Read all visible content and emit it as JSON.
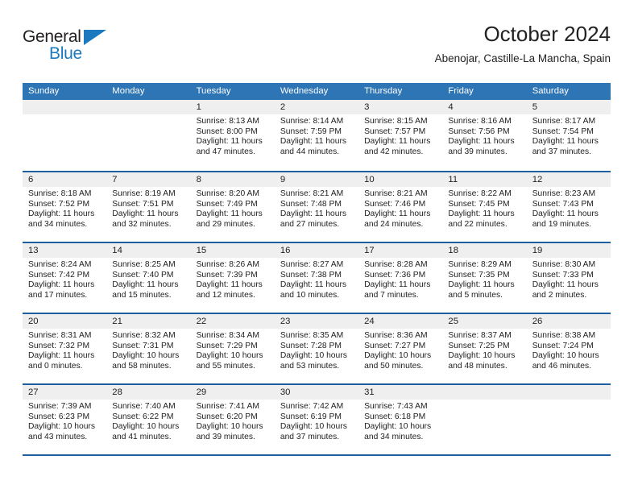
{
  "logo": {
    "word_one": "General",
    "word_two": "Blue",
    "triangle_color": "#1b7abf"
  },
  "header": {
    "title": "October 2024",
    "subtitle": "Abenojar, Castille-La Mancha, Spain"
  },
  "colors": {
    "header_blue": "#2e75b6",
    "separator_blue": "#1f5fa0",
    "day_band_gray": "#efefef"
  },
  "weekdays": [
    "Sunday",
    "Monday",
    "Tuesday",
    "Wednesday",
    "Thursday",
    "Friday",
    "Saturday"
  ],
  "labels": {
    "sunrise_prefix": "Sunrise:",
    "sunset_prefix": "Sunset:",
    "daylight_prefix": "Daylight:"
  },
  "weeks": [
    [
      {
        "date": "",
        "sunrise": "",
        "sunset": "",
        "daylight": ""
      },
      {
        "date": "",
        "sunrise": "",
        "sunset": "",
        "daylight": ""
      },
      {
        "date": "1",
        "sunrise": "Sunrise: 8:13 AM",
        "sunset": "Sunset: 8:00 PM",
        "daylight": "Daylight: 11 hours and 47 minutes."
      },
      {
        "date": "2",
        "sunrise": "Sunrise: 8:14 AM",
        "sunset": "Sunset: 7:59 PM",
        "daylight": "Daylight: 11 hours and 44 minutes."
      },
      {
        "date": "3",
        "sunrise": "Sunrise: 8:15 AM",
        "sunset": "Sunset: 7:57 PM",
        "daylight": "Daylight: 11 hours and 42 minutes."
      },
      {
        "date": "4",
        "sunrise": "Sunrise: 8:16 AM",
        "sunset": "Sunset: 7:56 PM",
        "daylight": "Daylight: 11 hours and 39 minutes."
      },
      {
        "date": "5",
        "sunrise": "Sunrise: 8:17 AM",
        "sunset": "Sunset: 7:54 PM",
        "daylight": "Daylight: 11 hours and 37 minutes."
      }
    ],
    [
      {
        "date": "6",
        "sunrise": "Sunrise: 8:18 AM",
        "sunset": "Sunset: 7:52 PM",
        "daylight": "Daylight: 11 hours and 34 minutes."
      },
      {
        "date": "7",
        "sunrise": "Sunrise: 8:19 AM",
        "sunset": "Sunset: 7:51 PM",
        "daylight": "Daylight: 11 hours and 32 minutes."
      },
      {
        "date": "8",
        "sunrise": "Sunrise: 8:20 AM",
        "sunset": "Sunset: 7:49 PM",
        "daylight": "Daylight: 11 hours and 29 minutes."
      },
      {
        "date": "9",
        "sunrise": "Sunrise: 8:21 AM",
        "sunset": "Sunset: 7:48 PM",
        "daylight": "Daylight: 11 hours and 27 minutes."
      },
      {
        "date": "10",
        "sunrise": "Sunrise: 8:21 AM",
        "sunset": "Sunset: 7:46 PM",
        "daylight": "Daylight: 11 hours and 24 minutes."
      },
      {
        "date": "11",
        "sunrise": "Sunrise: 8:22 AM",
        "sunset": "Sunset: 7:45 PM",
        "daylight": "Daylight: 11 hours and 22 minutes."
      },
      {
        "date": "12",
        "sunrise": "Sunrise: 8:23 AM",
        "sunset": "Sunset: 7:43 PM",
        "daylight": "Daylight: 11 hours and 19 minutes."
      }
    ],
    [
      {
        "date": "13",
        "sunrise": "Sunrise: 8:24 AM",
        "sunset": "Sunset: 7:42 PM",
        "daylight": "Daylight: 11 hours and 17 minutes."
      },
      {
        "date": "14",
        "sunrise": "Sunrise: 8:25 AM",
        "sunset": "Sunset: 7:40 PM",
        "daylight": "Daylight: 11 hours and 15 minutes."
      },
      {
        "date": "15",
        "sunrise": "Sunrise: 8:26 AM",
        "sunset": "Sunset: 7:39 PM",
        "daylight": "Daylight: 11 hours and 12 minutes."
      },
      {
        "date": "16",
        "sunrise": "Sunrise: 8:27 AM",
        "sunset": "Sunset: 7:38 PM",
        "daylight": "Daylight: 11 hours and 10 minutes."
      },
      {
        "date": "17",
        "sunrise": "Sunrise: 8:28 AM",
        "sunset": "Sunset: 7:36 PM",
        "daylight": "Daylight: 11 hours and 7 minutes."
      },
      {
        "date": "18",
        "sunrise": "Sunrise: 8:29 AM",
        "sunset": "Sunset: 7:35 PM",
        "daylight": "Daylight: 11 hours and 5 minutes."
      },
      {
        "date": "19",
        "sunrise": "Sunrise: 8:30 AM",
        "sunset": "Sunset: 7:33 PM",
        "daylight": "Daylight: 11 hours and 2 minutes."
      }
    ],
    [
      {
        "date": "20",
        "sunrise": "Sunrise: 8:31 AM",
        "sunset": "Sunset: 7:32 PM",
        "daylight": "Daylight: 11 hours and 0 minutes."
      },
      {
        "date": "21",
        "sunrise": "Sunrise: 8:32 AM",
        "sunset": "Sunset: 7:31 PM",
        "daylight": "Daylight: 10 hours and 58 minutes."
      },
      {
        "date": "22",
        "sunrise": "Sunrise: 8:34 AM",
        "sunset": "Sunset: 7:29 PM",
        "daylight": "Daylight: 10 hours and 55 minutes."
      },
      {
        "date": "23",
        "sunrise": "Sunrise: 8:35 AM",
        "sunset": "Sunset: 7:28 PM",
        "daylight": "Daylight: 10 hours and 53 minutes."
      },
      {
        "date": "24",
        "sunrise": "Sunrise: 8:36 AM",
        "sunset": "Sunset: 7:27 PM",
        "daylight": "Daylight: 10 hours and 50 minutes."
      },
      {
        "date": "25",
        "sunrise": "Sunrise: 8:37 AM",
        "sunset": "Sunset: 7:25 PM",
        "daylight": "Daylight: 10 hours and 48 minutes."
      },
      {
        "date": "26",
        "sunrise": "Sunrise: 8:38 AM",
        "sunset": "Sunset: 7:24 PM",
        "daylight": "Daylight: 10 hours and 46 minutes."
      }
    ],
    [
      {
        "date": "27",
        "sunrise": "Sunrise: 7:39 AM",
        "sunset": "Sunset: 6:23 PM",
        "daylight": "Daylight: 10 hours and 43 minutes."
      },
      {
        "date": "28",
        "sunrise": "Sunrise: 7:40 AM",
        "sunset": "Sunset: 6:22 PM",
        "daylight": "Daylight: 10 hours and 41 minutes."
      },
      {
        "date": "29",
        "sunrise": "Sunrise: 7:41 AM",
        "sunset": "Sunset: 6:20 PM",
        "daylight": "Daylight: 10 hours and 39 minutes."
      },
      {
        "date": "30",
        "sunrise": "Sunrise: 7:42 AM",
        "sunset": "Sunset: 6:19 PM",
        "daylight": "Daylight: 10 hours and 37 minutes."
      },
      {
        "date": "31",
        "sunrise": "Sunrise: 7:43 AM",
        "sunset": "Sunset: 6:18 PM",
        "daylight": "Daylight: 10 hours and 34 minutes."
      },
      {
        "date": "",
        "sunrise": "",
        "sunset": "",
        "daylight": ""
      },
      {
        "date": "",
        "sunrise": "",
        "sunset": "",
        "daylight": ""
      }
    ]
  ]
}
